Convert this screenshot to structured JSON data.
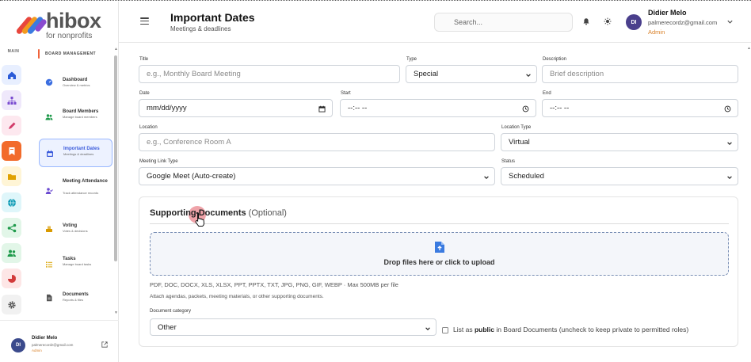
{
  "brand": {
    "name": "hibox",
    "tagline": "for nonprofits"
  },
  "rail": {
    "label": "MAIN",
    "items": [
      {
        "name": "home-icon",
        "color": "#2b5bd7",
        "bg": "#e8efff"
      },
      {
        "name": "org-chart-icon",
        "color": "#7a4bd0",
        "bg": "#efe8fb"
      },
      {
        "name": "marker-icon",
        "color": "#d23b6a",
        "bg": "#fde8ef"
      },
      {
        "name": "bookmark-icon",
        "color": "#ffffff",
        "bg": "#f26b2b"
      },
      {
        "name": "folder-icon",
        "color": "#e0a100",
        "bg": "#fff5d6"
      },
      {
        "name": "globe-icon",
        "color": "#0f9bb5",
        "bg": "#dff6fa"
      },
      {
        "name": "share-icon",
        "color": "#1f9a4b",
        "bg": "#e2f6e8"
      },
      {
        "name": "users-icon",
        "color": "#1f9a4b",
        "bg": "#e2f6e8"
      },
      {
        "name": "pie-icon",
        "color": "#d23b3b",
        "bg": "#fde6e6"
      },
      {
        "name": "gear-icon",
        "color": "#555555",
        "bg": "#f1f1f1"
      }
    ]
  },
  "nav": {
    "section": "BOARD MANAGEMENT",
    "items": [
      {
        "title": "Dashboard",
        "sub": "Overview & metrics",
        "icon": "dashboard-icon",
        "color": "#3b6ee0"
      },
      {
        "title": "Board Members",
        "sub": "Manage board members",
        "icon": "members-icon",
        "color": "#1f9a4b"
      },
      {
        "title": "Important Dates",
        "sub": "Meetings & deadlines",
        "icon": "calendar-icon",
        "color": "#3b5bdb",
        "active": true
      },
      {
        "title": "Meeting Attendance",
        "sub": "Track attendance records",
        "icon": "attendance-icon",
        "color": "#6b4bd0"
      },
      {
        "title": "Voting",
        "sub": "Votes & decisions",
        "icon": "vote-icon",
        "color": "#d99a00"
      },
      {
        "title": "Tasks",
        "sub": "Manage board tasks",
        "icon": "tasks-icon",
        "color": "#d9a400"
      },
      {
        "title": "Documents",
        "sub": "Reports & files",
        "icon": "document-icon",
        "color": "#555555"
      }
    ]
  },
  "user": {
    "initials": "DI",
    "name": "Didier Melo",
    "email": "palmerecordz@gmail.com",
    "role": "Admin"
  },
  "header": {
    "title": "Important Dates",
    "subtitle": "Meetings & deadlines",
    "search_placeholder": "Search..."
  },
  "form": {
    "title": {
      "label": "Title",
      "placeholder": "e.g., Monthly Board Meeting"
    },
    "type": {
      "label": "Type",
      "value": "Special"
    },
    "description": {
      "label": "Description",
      "placeholder": "Brief description"
    },
    "date": {
      "label": "Date",
      "value": "mm/dd/yyyy"
    },
    "start": {
      "label": "Start",
      "value": "--:-- --"
    },
    "end": {
      "label": "End",
      "value": "--:-- --"
    },
    "location": {
      "label": "Location",
      "placeholder": "e.g., Conference Room A"
    },
    "location_type": {
      "label": "Location Type",
      "value": "Virtual"
    },
    "meeting_link_type": {
      "label": "Meeting Link Type",
      "value": "Google Meet (Auto-create)"
    },
    "status": {
      "label": "Status",
      "value": "Scheduled"
    }
  },
  "documents": {
    "title": "Supporting Documents",
    "optional": "(Optional)",
    "dropzone_text": "Drop files here or click to upload",
    "formats": "PDF, DOC, DOCX, XLS, XLSX, PPT, PPTX, TXT, JPG, PNG, GIF, WEBP · Max 500MB per file",
    "hint": "Attach agendas, packets, meeting materials, or other supporting documents.",
    "category_label": "Document category",
    "category_value": "Other",
    "public_prefix": "List as",
    "public_bold": "public",
    "public_suffix": "in Board Documents (uncheck to keep private to permitted roles)"
  },
  "colors": {
    "accent": "#3b5bdb",
    "brand_orange": "#f26b2b",
    "admin": "#d9822b"
  }
}
